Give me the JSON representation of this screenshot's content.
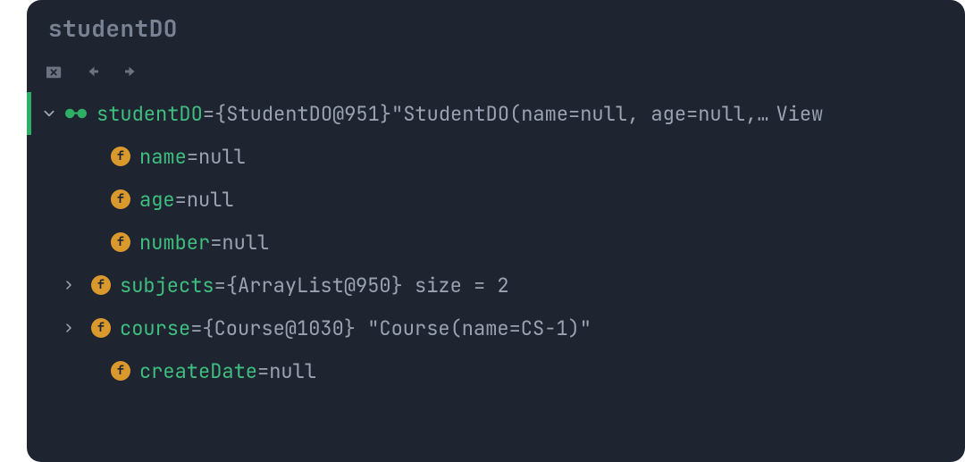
{
  "window": {
    "title": "studentDO"
  },
  "toolbar": {
    "close_icon": "close-x",
    "back_icon": "arrow-left",
    "forward_icon": "arrow-right"
  },
  "tree": {
    "root": {
      "expanded": true,
      "icon": "glasses",
      "name": "studentDO",
      "eq": " = ",
      "ref": "{StudentDO@951}",
      "str": " \"StudentDO(name=null, age=null,…",
      "view_link": " View"
    },
    "children": [
      {
        "kind": "field",
        "expand": "",
        "name": "name",
        "eq": " = ",
        "value": "null",
        "value_cls": "val-null"
      },
      {
        "kind": "field",
        "expand": "",
        "name": "age",
        "eq": " = ",
        "value": "null",
        "value_cls": "val-null"
      },
      {
        "kind": "field",
        "expand": "",
        "name": "number",
        "eq": " = ",
        "value": "null",
        "value_cls": "val-null"
      },
      {
        "kind": "field",
        "expand": ">",
        "name": "subjects",
        "eq": " = ",
        "value": "{ArrayList@950}  size = 2",
        "value_cls": "val-ref"
      },
      {
        "kind": "field",
        "expand": ">",
        "name": "course",
        "eq": " = ",
        "value": "{Course@1030} \"Course(name=CS-1)\"",
        "value_cls": "val-ref"
      },
      {
        "kind": "field",
        "expand": "",
        "name": "createDate",
        "eq": " = ",
        "value": "null",
        "value_cls": "val-null"
      }
    ],
    "field_badge": "f"
  }
}
